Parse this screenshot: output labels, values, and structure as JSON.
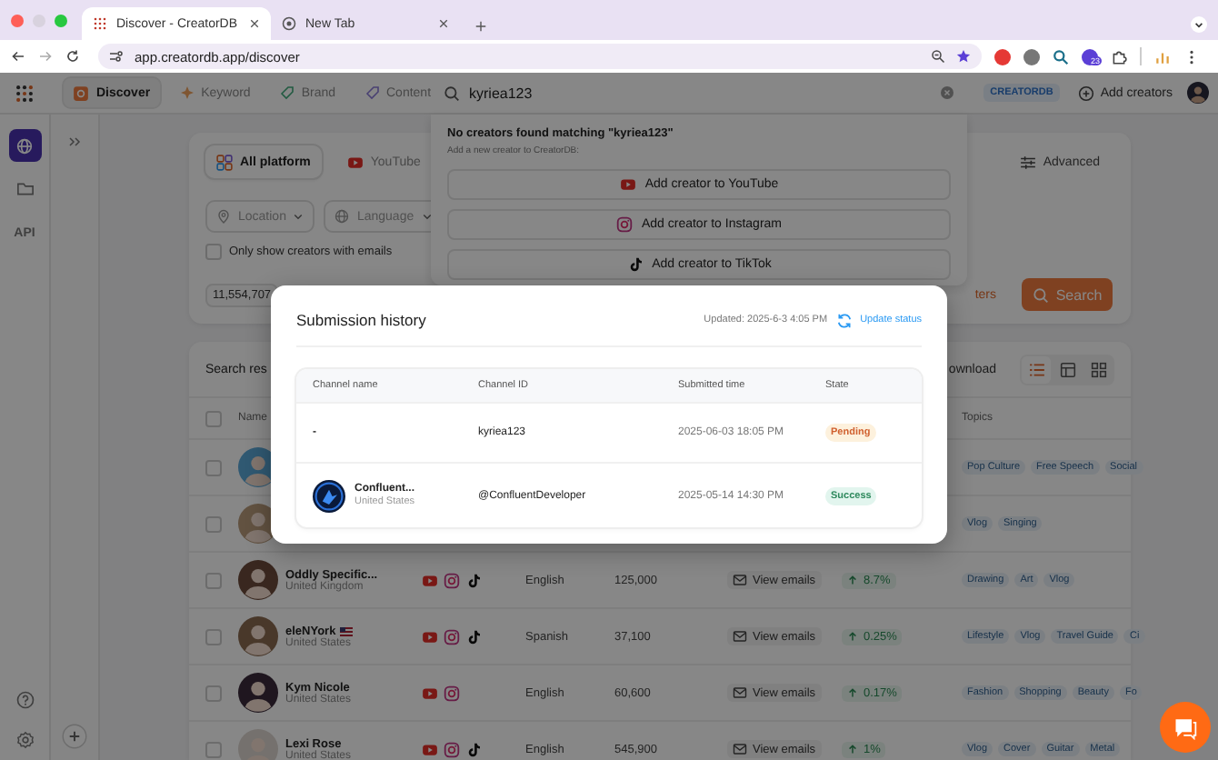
{
  "browser": {
    "tabs": [
      {
        "title": "Discover - CreatorDB",
        "selected": true
      },
      {
        "title": "New Tab",
        "selected": false
      }
    ],
    "url": "app.creatordb.app/discover",
    "extension_badge": "23"
  },
  "topbar": {
    "nav": [
      {
        "label": "Discover",
        "kind": "discover",
        "selected": true
      },
      {
        "label": "Keyword",
        "kind": "keyword",
        "selected": false
      },
      {
        "label": "Brand",
        "kind": "brand",
        "selected": false
      },
      {
        "label": "Content",
        "kind": "content",
        "selected": false
      }
    ],
    "search": {
      "value": "kyriea123"
    },
    "brand_badge": "CREATORDB",
    "add_button": "Add creators"
  },
  "sidebar": {
    "items": [
      {
        "kind": "globe",
        "selected": true
      },
      {
        "kind": "folder",
        "selected": false
      },
      {
        "kind": "text",
        "label": "API",
        "selected": false
      }
    ]
  },
  "filters": {
    "platform_tabs": [
      {
        "label": "All platform",
        "kind": "all",
        "selected": true
      },
      {
        "label": "YouTube",
        "kind": "youtube",
        "selected": false
      }
    ],
    "advanced": "Advanced",
    "selects": [
      {
        "label": "Location",
        "kind": "location"
      },
      {
        "label": "Language",
        "kind": "language"
      }
    ],
    "email_filter": {
      "label": "Only show creators with emails",
      "checked": false
    },
    "count": "11,554,707",
    "clear_link": "ters",
    "search_button": "Search"
  },
  "results": {
    "title": "Search res",
    "download": "ownload",
    "views": [
      {
        "kind": "list",
        "selected": true
      },
      {
        "kind": "table",
        "selected": false
      },
      {
        "kind": "grid",
        "selected": false
      }
    ],
    "columns": {
      "name": "Name",
      "topics": "Topics"
    },
    "select_all": {
      "checked": false
    },
    "rows": [
      {
        "checked": false,
        "topics": [
          "Pop Culture",
          "Free Speech",
          "Social"
        ]
      },
      {
        "checked": false,
        "topics": [
          "Vlog",
          "Singing"
        ]
      },
      {
        "checked": false,
        "name": "Oddly Specific...",
        "flag": false,
        "country": "United Kingdom",
        "platforms": [
          {
            "kind": "youtube"
          },
          {
            "kind": "instagram"
          },
          {
            "kind": "tiktok"
          }
        ],
        "language": "English",
        "followers": "125,000",
        "emails": "View emails",
        "growth": "8.7%",
        "topics": [
          "Drawing",
          "Art",
          "Vlog"
        ]
      },
      {
        "checked": false,
        "name": "eleNYork",
        "flag": true,
        "country": "United States",
        "platforms": [
          {
            "kind": "youtube"
          },
          {
            "kind": "instagram"
          },
          {
            "kind": "tiktok"
          }
        ],
        "language": "Spanish",
        "followers": "37,100",
        "emails": "View emails",
        "growth": "0.25%",
        "topics": [
          "Lifestyle",
          "Vlog",
          "Travel Guide",
          "Ci"
        ]
      },
      {
        "checked": false,
        "name": "Kym Nicole",
        "flag": false,
        "country": "United States",
        "platforms": [
          {
            "kind": "youtube"
          },
          {
            "kind": "instagram"
          }
        ],
        "language": "English",
        "followers": "60,600",
        "emails": "View emails",
        "growth": "0.17%",
        "topics": [
          "Fashion",
          "Shopping",
          "Beauty",
          "Fo"
        ]
      },
      {
        "checked": false,
        "name": "Lexi Rose",
        "flag": false,
        "country": "United States",
        "platforms": [
          {
            "kind": "youtube"
          },
          {
            "kind": "instagram"
          },
          {
            "kind": "tiktok"
          }
        ],
        "language": "English",
        "followers": "545,900",
        "emails": "View emails",
        "growth": "1%",
        "topics": [
          "Vlog",
          "Cover",
          "Guitar",
          "Metal"
        ]
      }
    ]
  },
  "dropdown": {
    "title": "No creators found matching \"kyriea123\"",
    "subtitle": "Add a new creator to CreatorDB:",
    "actions": [
      {
        "label": "Add creator to YouTube",
        "kind": "youtube"
      },
      {
        "label": "Add creator to Instagram",
        "kind": "instagram"
      },
      {
        "label": "Add creator to TikTok",
        "kind": "tiktok"
      }
    ]
  },
  "modal": {
    "title": "Submission history",
    "updated": "Updated: 2025-6-3 4:05 PM",
    "update_button": "Update status",
    "columns": [
      "Channel name",
      "Channel ID",
      "Submitted time",
      "State"
    ],
    "rows": [
      {
        "channel_name": "-",
        "has_avatar": false,
        "channel_id": "kyriea123",
        "submitted": "2025-06-03 18:05 PM",
        "state": {
          "label": "Pending",
          "kind": "pending"
        }
      },
      {
        "channel_name": "Confluent...",
        "has_avatar": true,
        "country": "United States",
        "channel_id": "@ConfluentDeveloper",
        "submitted": "2025-05-14 14:30 PM",
        "state": {
          "label": "Success",
          "kind": "success"
        }
      }
    ]
  }
}
